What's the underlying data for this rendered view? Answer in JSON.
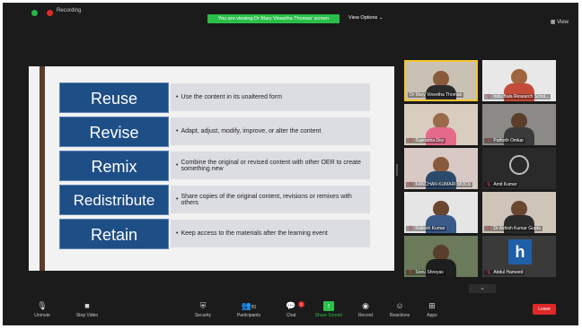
{
  "topbar": {
    "recording": "Recording",
    "viewing_banner": "You are viewing Dr Mary Vineetha Thomas' screen",
    "view_options": "View Options ⌄",
    "view": "View"
  },
  "slide": {
    "rows": [
      {
        "term": "Reuse",
        "desc": "Use the content in its unaltered form"
      },
      {
        "term": "Revise",
        "desc": "Adapt, adjust, modify, improve, or alter the content"
      },
      {
        "term": "Remix",
        "desc": "Combine the original or revised content with other OER to create something new"
      },
      {
        "term": "Redistribute",
        "desc": "Share copies of the original content, revisions or remixes with others"
      },
      {
        "term": "Retain",
        "desc": "Keep access to the materials after the learning event"
      }
    ],
    "bullet": "•"
  },
  "participants": [
    {
      "name": "Dr Mary Vineetha Thomas",
      "active": true
    },
    {
      "name": "Indu Bala Research Schol..."
    },
    {
      "name": "Suprabha Dey"
    },
    {
      "name": "Pathoth Omkar"
    },
    {
      "name": "KANCHAN KUMARI MOCU"
    },
    {
      "name": "Amit Kumar"
    },
    {
      "name": "Rakesh Kumar"
    },
    {
      "name": "Dr Ashish Kumar Gupta"
    },
    {
      "name": "Sonu Shreyas"
    },
    {
      "name": "Abdul Hameed",
      "logo": "h"
    }
  ],
  "toolbar": {
    "unmute": "Unmute",
    "stop_video": "Stop Video",
    "security": "Security",
    "participants": "Participants",
    "participants_count": "81",
    "chat": "Chat",
    "chat_badge": "2",
    "share_screen": "Share Screen",
    "record": "Record",
    "reactions": "Reactions",
    "apps": "Apps",
    "leave": "Leave"
  },
  "icons": {
    "mic": "mic-icon",
    "video": "video-icon",
    "security": "shield-icon",
    "participants": "people-icon",
    "chat": "chat-icon",
    "share": "share-screen-icon",
    "record": "record-icon",
    "reactions": "smile-icon",
    "apps": "apps-icon"
  }
}
